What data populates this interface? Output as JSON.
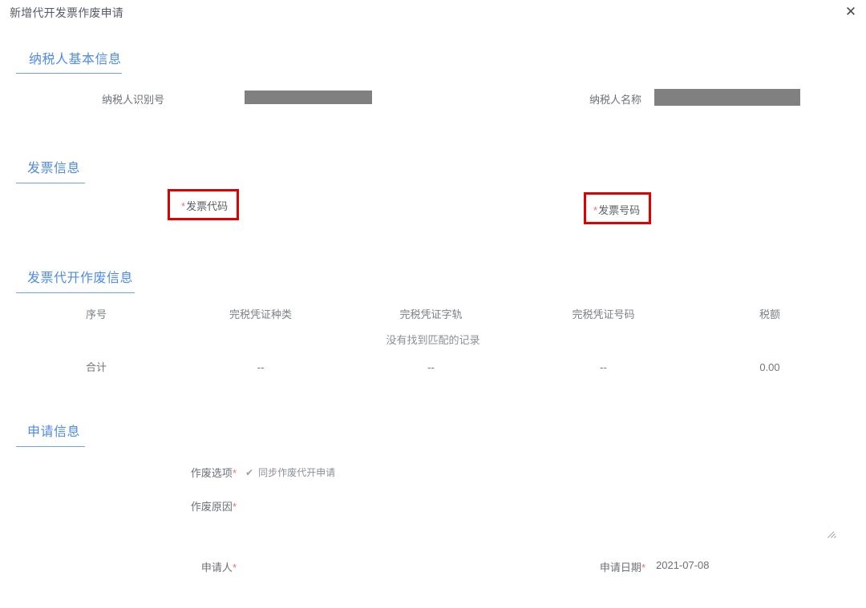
{
  "window": {
    "title": "新增代开发票作废申请",
    "close_icon": "close-icon",
    "close_glyph": "✕"
  },
  "sections": {
    "taxpayer": {
      "heading": "纳税人基本信息",
      "fields": {
        "taxpayer_id_label": "纳税人识别号",
        "taxpayer_id_value": "",
        "taxpayer_name_label": "纳税人名称",
        "taxpayer_name_value": ""
      }
    },
    "invoice": {
      "heading": "发票信息",
      "fields": {
        "invoice_code_label": "发票代码",
        "invoice_number_label": "发票号码",
        "required_mark": "*"
      }
    },
    "void_info": {
      "heading": "发票代开作废信息",
      "table": {
        "columns": [
          "序号",
          "完税凭证种类",
          "完税凭证字轨",
          "完税凭证号码",
          "税额"
        ],
        "rows": [],
        "empty_text": "没有找到匹配的记录",
        "total_row": [
          "合计",
          "--",
          "--",
          "--",
          "0.00"
        ]
      }
    },
    "application": {
      "heading": "申请信息",
      "fields": {
        "void_option_label": "作废选项",
        "void_option_checkbox_glyph": "✔",
        "void_option_checkbox_text": "同步作废代开申请",
        "void_reason_label": "作废原因",
        "void_reason_value": "",
        "applicant_label": "申请人",
        "applicant_value": "",
        "apply_date_label": "申请日期",
        "apply_date_value": "2021-07-08",
        "required_mark": "*"
      }
    }
  },
  "annotations": {
    "box1_target": "invoice-code-label",
    "box2_target": "invoice-number-label",
    "color": "#e00000"
  },
  "colors": {
    "section_blue": "#4f8ae8",
    "required_red": "#f56c6c",
    "redacted_gray": "#808080",
    "annotation_red": "#e00000"
  }
}
